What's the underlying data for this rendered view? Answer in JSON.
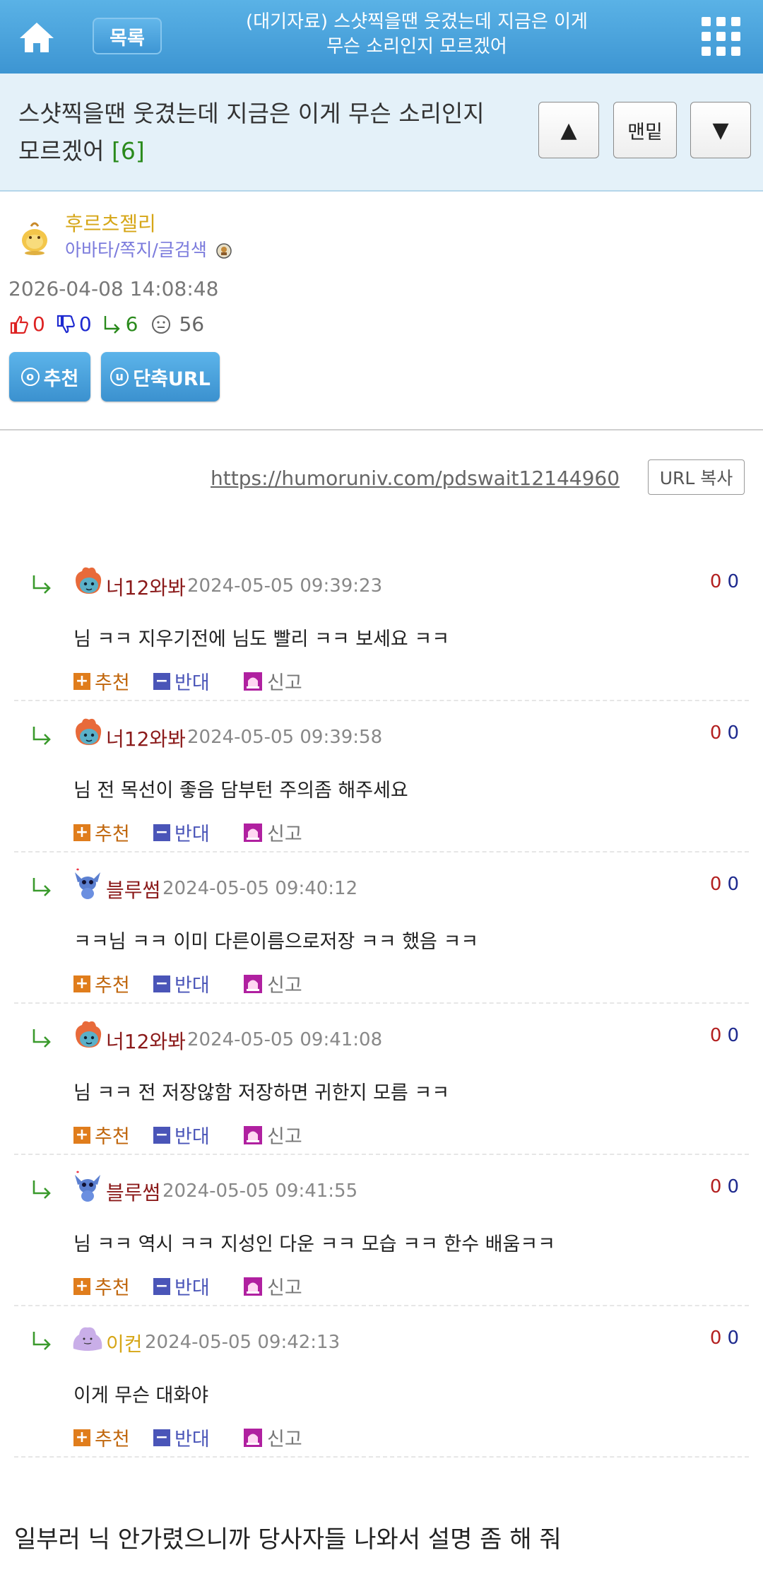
{
  "header": {
    "list_label": "목록",
    "title_line1": "(대기자료) 스샷찍을땐 웃겼는데 지금은 이게",
    "title_line2": "무슨 소리인지 모르겠어"
  },
  "post": {
    "title_line1": "스샷찍을땐 웃겼는데 지금은 이게 무슨 소리인지",
    "title_line2": "모르겠어",
    "comment_count": "[6]",
    "nav_up": "▲",
    "nav_bottom": "맨밑",
    "nav_down": "▼",
    "author": "후르츠젤리",
    "author_links": "아바타/쪽지/글검색",
    "date": "2026-04-08 14:08:48",
    "likes": "0",
    "dislikes": "0",
    "replies": "6",
    "views": "56",
    "recommend_icon": "o",
    "recommend_label": "추천",
    "short_url_icon": "u",
    "short_url_label": "단축URL",
    "url": "https://humoruniv.com/pdswait12144960",
    "url_copy_label": "URL 복사"
  },
  "comment_actions": {
    "recommend": "추천",
    "oppose": "반대",
    "report": "신고",
    "plus": "+",
    "minus": "−"
  },
  "comments": [
    {
      "nick": "너12와봐",
      "date": "2024-05-05 09:39:23",
      "text": "님 ㅋㅋ 지우기전에 님도 빨리 ㅋㅋ 보세요 ㅋㅋ",
      "up": "0",
      "down": "0",
      "nick_color": "#8b1a1a",
      "avatar": "dragon"
    },
    {
      "nick": "너12와봐",
      "date": "2024-05-05 09:39:58",
      "text": "님 전 목선이 좋음 담부턴 주의좀 해주세요",
      "up": "0",
      "down": "0",
      "nick_color": "#8b1a1a",
      "avatar": "dragon"
    },
    {
      "nick": "블루썸",
      "date": "2024-05-05 09:40:12",
      "text": "ㅋㅋ님 ㅋㅋ 이미 다른이름으로저장 ㅋㅋ 했음 ㅋㅋ",
      "up": "0",
      "down": "0",
      "nick_color": "#8b1a1a",
      "avatar": "stitch"
    },
    {
      "nick": "너12와봐",
      "date": "2024-05-05 09:41:08",
      "text": "님 ㅋㅋ 전 저장않함 저장하면 귀한지 모름 ㅋㅋ",
      "up": "0",
      "down": "0",
      "nick_color": "#8b1a1a",
      "avatar": "dragon"
    },
    {
      "nick": "블루썸",
      "date": "2024-05-05 09:41:55",
      "text": "님 ㅋㅋ 역시 ㅋㅋ 지성인 다운 ㅋㅋ 모습 ㅋㅋ 한수 배움ㅋㅋ",
      "up": "0",
      "down": "0",
      "nick_color": "#8b1a1a",
      "avatar": "stitch"
    },
    {
      "nick": "이컨",
      "date": "2024-05-05 09:42:13",
      "text": "이게 무슨 대화야",
      "up": "0",
      "down": "0",
      "nick_color": "#d6a617",
      "avatar": "ditto"
    }
  ],
  "footer_text": "일부러 닉 안가렸으니까 당사자들 나와서 설명 좀 해 줘",
  "colors": {
    "header_blue": "#4aa6e0",
    "title_bg": "#e4f1f9",
    "recommend_orange": "#e07d1c",
    "oppose_blue": "#4a55b8",
    "report_purple": "#b020a0"
  },
  "icons": {
    "home": "home-icon",
    "menu": "grid-menu-icon",
    "reply": "reply-arrow-icon",
    "thumb_up": "thumbs-up-icon",
    "thumb_down": "thumbs-down-icon",
    "views": "smiley-icon"
  }
}
